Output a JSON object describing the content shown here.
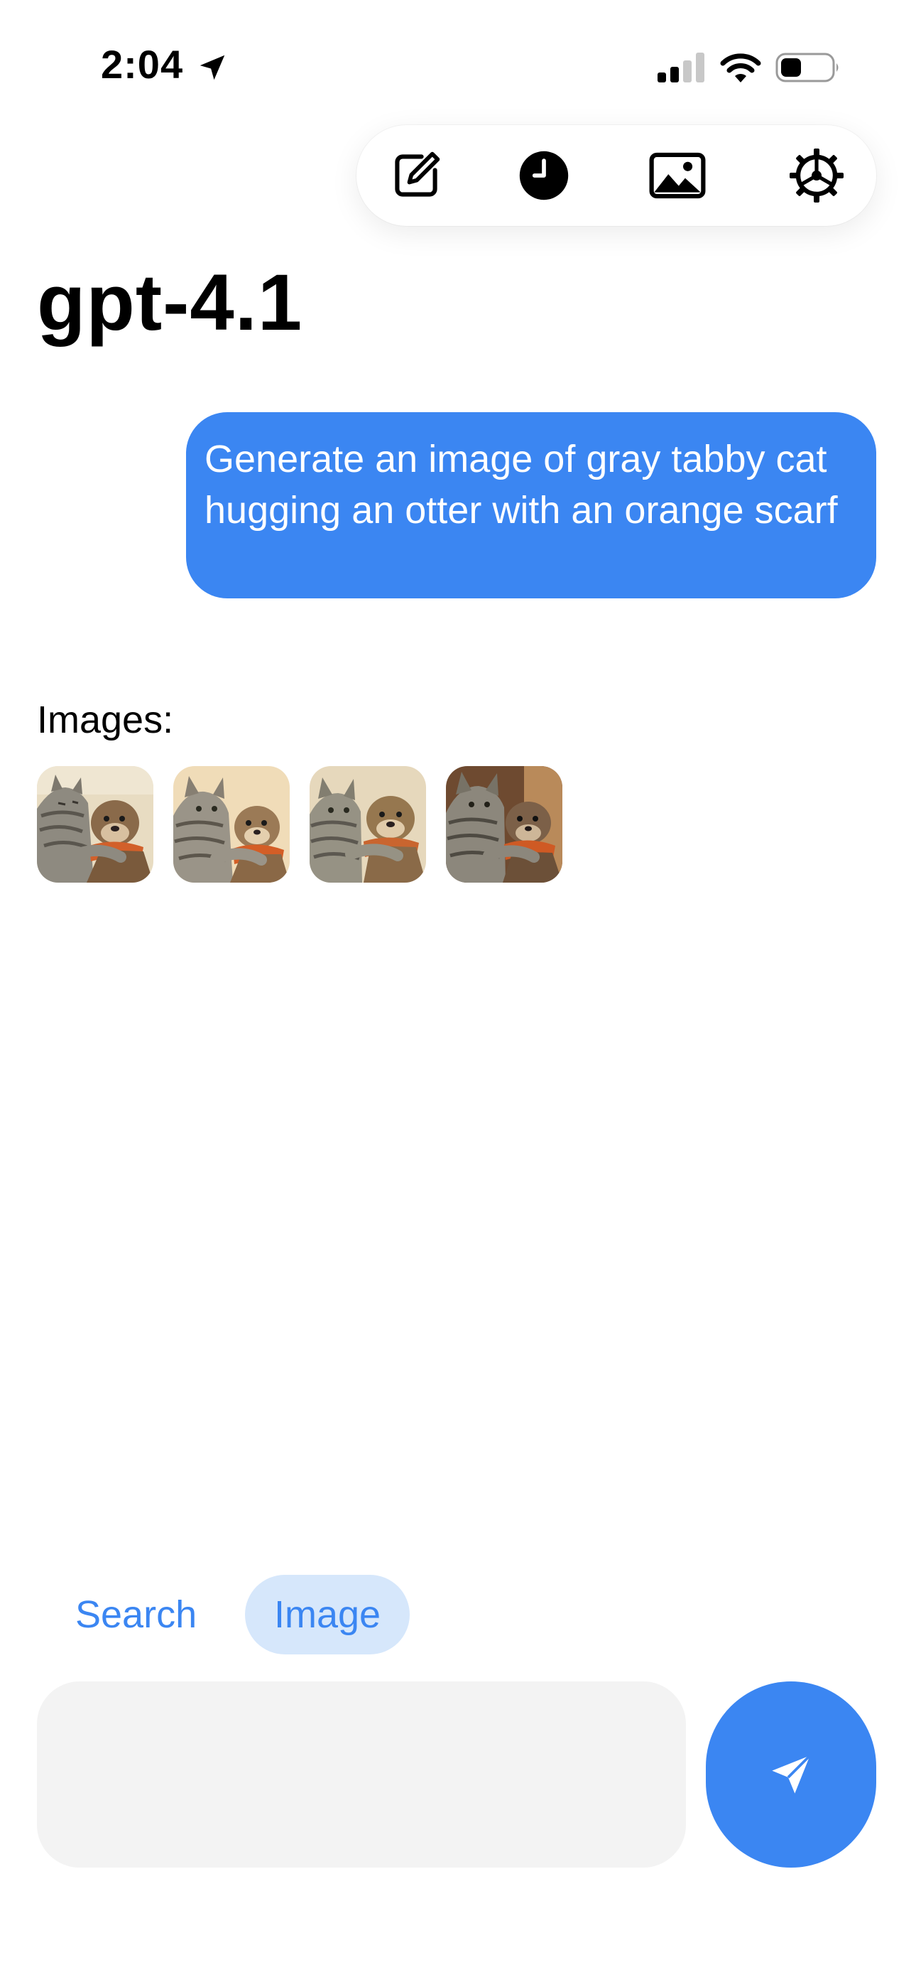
{
  "status_bar": {
    "time": "2:04",
    "icons": [
      "location-arrow-icon",
      "cellular-signal-icon",
      "wifi-icon",
      "battery-icon"
    ]
  },
  "toolbar": {
    "items": [
      {
        "name": "new-chat",
        "icon": "compose-icon"
      },
      {
        "name": "history",
        "icon": "clock-icon"
      },
      {
        "name": "images",
        "icon": "photo-icon"
      },
      {
        "name": "settings",
        "icon": "gear-icon"
      }
    ]
  },
  "header": {
    "title": "gpt-4.1"
  },
  "conversation": {
    "user_message": "Generate an image of gray tabby cat hugging an otter with an orange scarf",
    "images_label": "Images:",
    "image_count": 4
  },
  "modes": {
    "search_label": "Search",
    "image_label": "Image",
    "selected": "Image"
  },
  "composer": {
    "value": "",
    "placeholder": ""
  },
  "colors": {
    "accent": "#3b86f2",
    "chip_selected_bg": "#d6e7fb",
    "input_bg": "#f3f3f3",
    "bubble_text": "#ffffff"
  }
}
